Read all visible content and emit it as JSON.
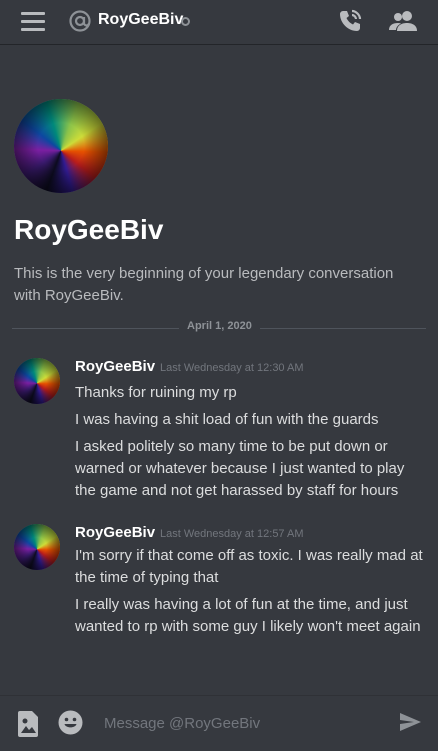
{
  "header": {
    "title": "RoyGeeBiv",
    "icons": [
      "menu-icon",
      "at-icon",
      "status-dot-icon",
      "call-icon",
      "members-icon"
    ]
  },
  "intro": {
    "name": "RoyGeeBiv",
    "description": "This is the very beginning of your legendary conversation with RoyGeeBiv."
  },
  "date_divider": "April 1, 2020",
  "messages": [
    {
      "author": "RoyGeeBiv",
      "timestamp": "Last Wednesday at 12:30 AM",
      "lines": [
        "Thanks for ruining my rp",
        "I was having a shit load of fun with the guards",
        "I asked politely so many time to be put down or warned or whatever because I just wanted to play the game and not get harassed by staff for hours"
      ]
    },
    {
      "author": "RoyGeeBiv",
      "timestamp": "Last Wednesday at 12:57 AM",
      "lines": [
        "I'm sorry if that come off as toxic. I was really mad at the time of typing that",
        "I really was having a lot of fun at the time, and just wanted to rp with some guy I likely won't meet again"
      ]
    }
  ],
  "composer": {
    "placeholder": "Message @RoyGeeBiv",
    "icons": [
      "media-icon",
      "emoji-icon",
      "send-icon"
    ]
  },
  "colors": {
    "background": "#36393f",
    "text": "#dcddde",
    "muted": "#72767d",
    "heading": "#ffffff"
  }
}
